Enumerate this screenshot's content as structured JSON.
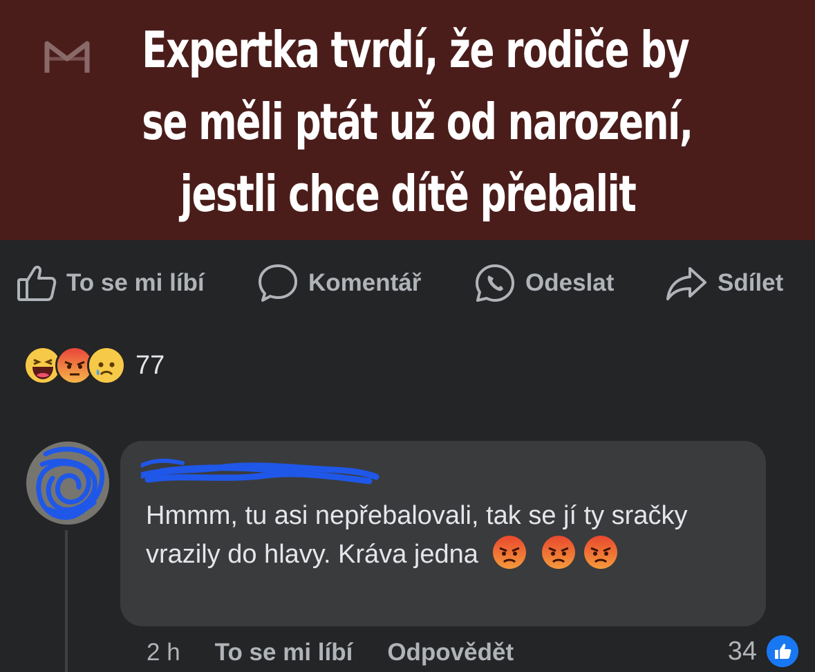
{
  "post": {
    "headline_lines": [
      "Expertka tvrdí, že rodiče by",
      "se měli ptát už od narození,",
      "jestli chce dítě přebalit"
    ],
    "banner_color": "#4a1d1b",
    "logo_icon": "m-logo-icon"
  },
  "actions": [
    {
      "label": "To se mi líbí",
      "icon": "thumbs-up-icon"
    },
    {
      "label": "Komentář",
      "icon": "comment-icon"
    },
    {
      "label": "Odeslat",
      "icon": "whatsapp-icon"
    },
    {
      "label": "Sdílet",
      "icon": "share-icon"
    }
  ],
  "reactions": {
    "icons": [
      "haha-icon",
      "angry-icon",
      "sad-icon"
    ],
    "count": "77"
  },
  "comment": {
    "text": "Hmmm, tu asi nepřebalovali, tak se jí ty sračky vrazily do hlavy. Kráva jedna",
    "emojis": [
      "angry-emoji",
      "angry-emoji",
      "angry-emoji"
    ],
    "time": "2 h",
    "like_label": "To se mi líbí",
    "reply_label": "Odpovědět",
    "like_count": "34"
  },
  "colors": {
    "background": "#242526",
    "bubble": "#3a3b3c",
    "like_blue": "#1877f2",
    "muted_text": "#b0b3b8"
  }
}
